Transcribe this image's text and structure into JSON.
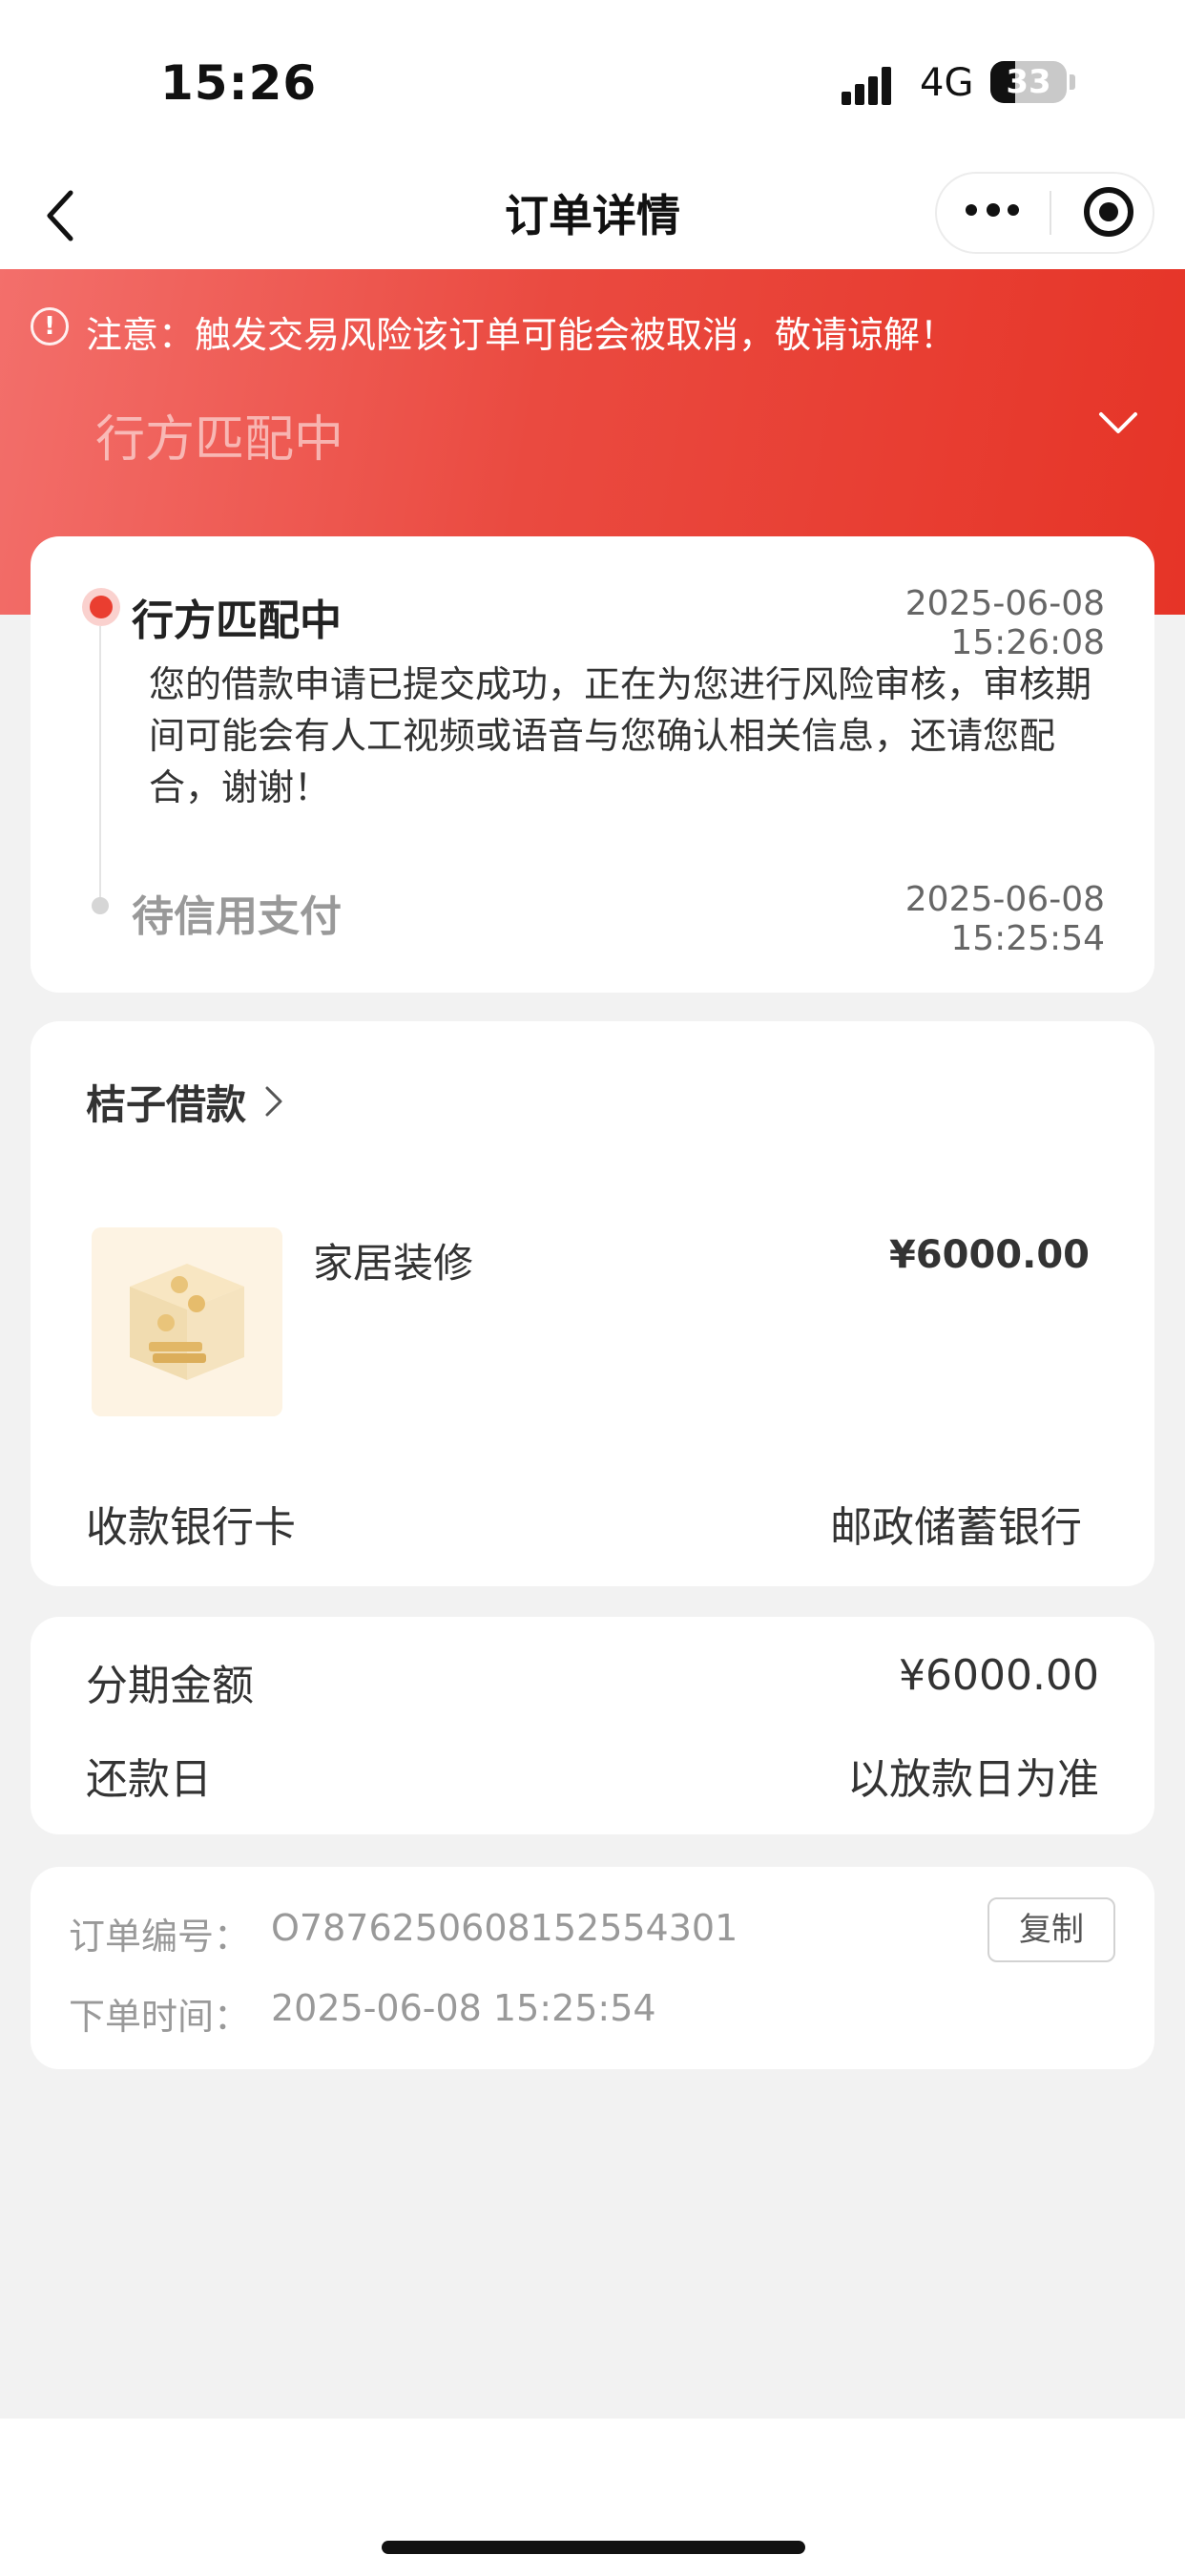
{
  "status_bar": {
    "time": "15:26",
    "network": "4G",
    "battery": "33",
    "battery_level": 0.33
  },
  "nav": {
    "title": "订单详情"
  },
  "header": {
    "warning": "注意：触发交易风险该订单可能会被取消，敬请谅解！",
    "status": "行方匹配中",
    "warning_icon": "!"
  },
  "timeline": {
    "steps": [
      {
        "title": "行方匹配中",
        "time": "2025-06-08 15:26:08",
        "desc": "您的借款申请已提交成功，正在为您进行风险审核，审核期间可能会有人工视频或语音与您确认相关信息，还请您配合，谢谢！"
      },
      {
        "title": "待信用支付",
        "time": "2025-06-08 15:25:54"
      }
    ]
  },
  "product": {
    "merchant": "桔子借款",
    "name": "家居装修",
    "price": "¥6000.00",
    "bank_label": "收款银行卡",
    "bank_value": "邮政储蓄银行"
  },
  "installment": {
    "amount_label": "分期金额",
    "amount_value": "¥6000.00",
    "due_label": "还款日",
    "due_value": "以放款日为准"
  },
  "order": {
    "no_label": "订单编号：",
    "no_value": "O78762506081525543​01",
    "copy_label": "复制",
    "time_label": "下单时间：",
    "time_value": "2025-06-08 15:25:54"
  },
  "colors": {
    "accent": "#e63427",
    "header_start": "#f36f6b"
  }
}
